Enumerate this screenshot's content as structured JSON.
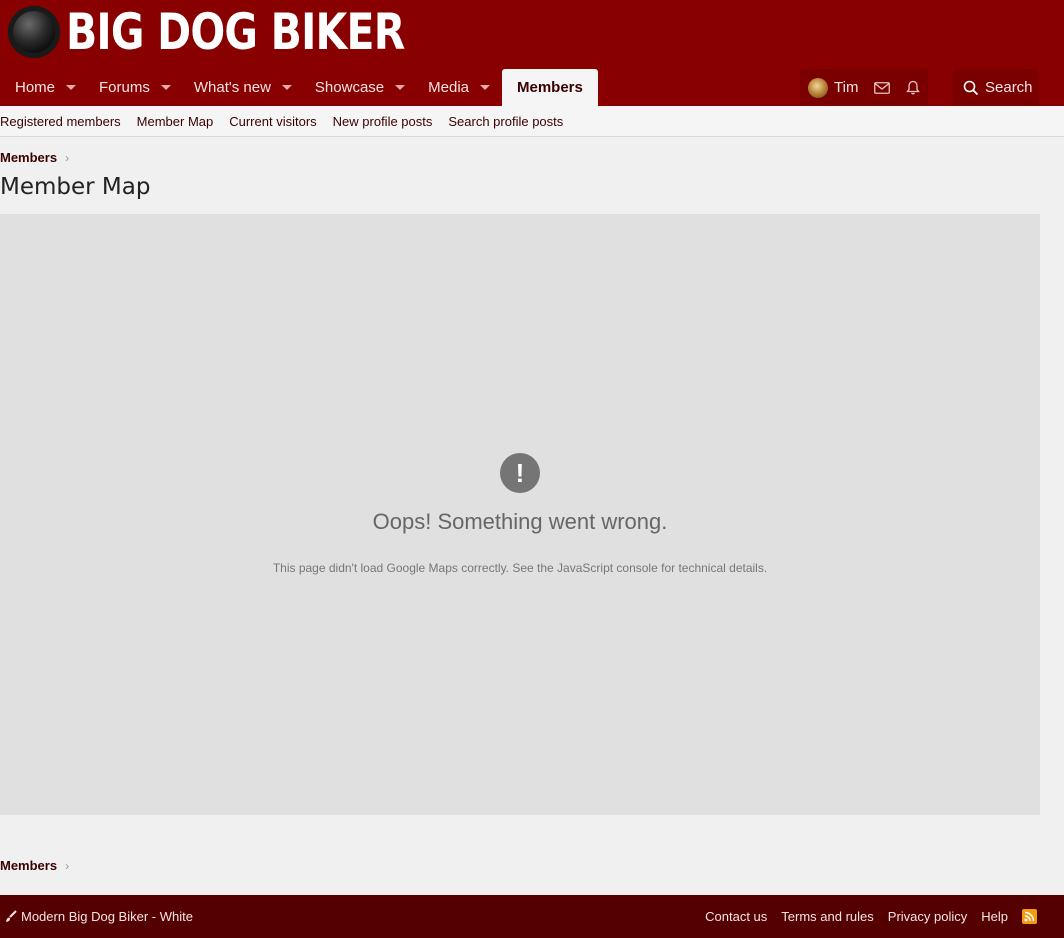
{
  "header": {
    "logo_text": "BIG DOG BIKER",
    "nav_tabs": [
      {
        "label": "Home"
      },
      {
        "label": "Forums"
      },
      {
        "label": "What's new"
      },
      {
        "label": "Showcase"
      },
      {
        "label": "Media"
      },
      {
        "label": "Members"
      }
    ],
    "user_name": "Tim",
    "search_label": "Search"
  },
  "subnav": {
    "items": [
      "Registered members",
      "Member Map",
      "Current visitors",
      "New profile posts",
      "Search profile posts"
    ]
  },
  "breadcrumb_top": "Members",
  "page_title": "Member Map",
  "map_error": {
    "title": "Oops! Something went wrong.",
    "detail": "This page didn't load Google Maps correctly. See the JavaScript console for technical details."
  },
  "breadcrumb_bottom": "Members",
  "footer": {
    "style_label": "Modern Big Dog Biker - White",
    "links": [
      "Contact us",
      "Terms and rules",
      "Privacy policy",
      "Help"
    ]
  },
  "colors": {
    "header_bg": "#880000",
    "footer_bg": "#550000",
    "link": "#3a0000",
    "rss": "#f39c12"
  }
}
